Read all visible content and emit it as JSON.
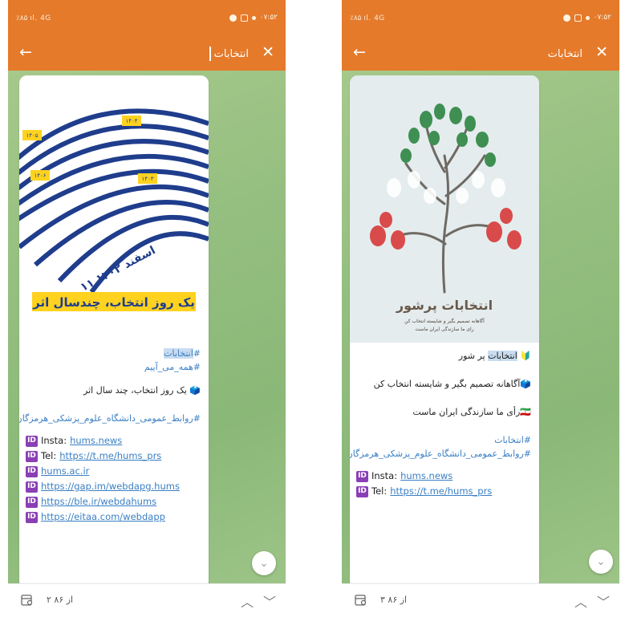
{
  "left": {
    "statusbar": {
      "left_text": "٪۸۵ ıl. 4G",
      "right_text": "۰۷:۵۲"
    },
    "appbar": {
      "search_value": "انتخابات",
      "back": "←",
      "close": "✕"
    },
    "poster": {
      "slogan": "یک روز انتخاب، چندسال اثر",
      "date": "۱۱ اسفند ۱۴۰۲",
      "years": [
        "۱۴۰۴",
        "۱۴۰۵",
        "۱۴۰۶",
        "۱۴۰۳"
      ]
    },
    "message": {
      "tag1_highlight": "انتخابات",
      "tag1_hash": "#",
      "tag2": "#همه_می_آییم",
      "line1": "یک روز انتخاب، چند سال اثر",
      "tag3": "#روابط_عمومی_دانشگاه_علوم_پزشکی_هرمزگان"
    },
    "links": [
      {
        "prefix": "Insta: ",
        "text": "hums.news"
      },
      {
        "prefix": "Tel: ",
        "text": "https://t.me/hums_prs"
      },
      {
        "prefix": "",
        "text": "hums.ac.ir"
      },
      {
        "prefix": "",
        "text": "https://gap.im/webdapg.hums"
      },
      {
        "prefix": "",
        "text": "https://ble.ir/webdahums"
      },
      {
        "prefix": "",
        "text": "https://eitaa.com/webdapp"
      }
    ],
    "bottombar": {
      "counter": "۲ از ۸۶"
    }
  },
  "right": {
    "statusbar": {
      "left_text": "٪۸۵ ıl. 4G",
      "right_text": "۰۷:۵۲"
    },
    "appbar": {
      "title": "انتخابات",
      "back": "←",
      "close": "✕"
    },
    "poster": {
      "title": "انتخابات پرشور",
      "sub1": "آگاهانه تصمیم بگیر و شایسته انتخاب کن",
      "sub2": "رای ما سازندگی ایران ماست"
    },
    "message": {
      "title_hl": "انتخابات",
      "title_rest": " پر شور",
      "line2": "آگاهانه تصمیم بگیر و شایسته انتخاب کن",
      "line3": "رأی ما سازندگی ایران ماست",
      "tag1": "#انتخابات",
      "tag2": "#روابط_عمومی_دانشگاه_علوم_پزشکی_هرمزگان"
    },
    "links": [
      {
        "prefix": "Insta: ",
        "text": "hums.news"
      },
      {
        "prefix": "Tel: ",
        "text": "https://t.me/hums_prs"
      }
    ],
    "bottombar": {
      "counter": "۳ از ۸۶"
    }
  },
  "colors": {
    "accent": "#e57a2b",
    "link": "#3a7fc4",
    "highlight": "#c9dcf0",
    "id_badge": "#8a3fb5"
  }
}
